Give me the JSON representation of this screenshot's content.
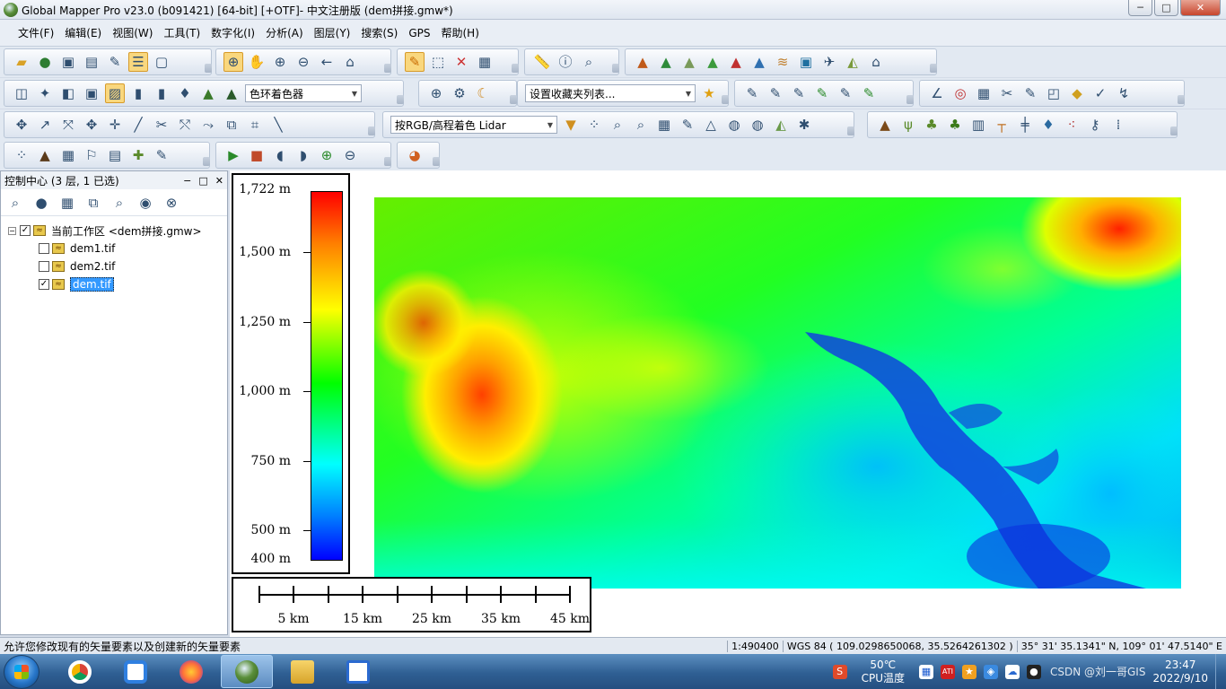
{
  "window": {
    "title": "Global Mapper Pro v23.0 (b091421) [64-bit] [+OTF]- 中文注册版 (dem拼接.gmw*)",
    "minimize": "─",
    "maximize": "□",
    "close": "✕"
  },
  "menu": [
    "文件(F)",
    "编辑(E)",
    "视图(W)",
    "工具(T)",
    "数字化(I)",
    "分析(A)",
    "图层(Y)",
    "搜索(S)",
    "GPS",
    "帮助(H)"
  ],
  "toolbar": {
    "shader_dropdown": "色环着色器",
    "favorites_dropdown": "设置收藏夹列表...",
    "lidar_dropdown": "按RGB/高程着色 Lidar"
  },
  "control_center": {
    "title": "控制中心 (3 层, 1 已选)",
    "workspace_label": "当前工作区 <dem拼接.gmw>",
    "layers": [
      {
        "name": "dem1.tif",
        "checked": false
      },
      {
        "name": "dem2.tif",
        "checked": false
      },
      {
        "name": "dem.tif",
        "checked": true
      }
    ]
  },
  "legend": {
    "labels": [
      "1,722 m",
      "1,500 m",
      "1,250 m",
      "1,000 m",
      "750 m",
      "500 m",
      "400 m"
    ]
  },
  "scale_bar": {
    "labels": [
      "5 km",
      "15 km",
      "25 km",
      "35 km",
      "45 km"
    ]
  },
  "status": {
    "message": "允许您修改现有的矢量要素以及创建新的矢量要素",
    "scale": "1:490400",
    "datum": "WGS 84 ( 109.0298650068, 35.5264261302 )",
    "coords": "35° 31' 35.1341\" N, 109° 01' 47.5140\" E"
  },
  "taskbar": {
    "temperature": "50℃",
    "temp_label": "CPU温度",
    "time": "23:47",
    "date": "2022/9/10",
    "watermark": "CSDN @刘一哥GIS"
  },
  "colors": {
    "ramp_high": "#ff0000",
    "ramp_mid": "#00ff00",
    "ramp_low": "#0000ff",
    "selection": "#3399ff"
  }
}
